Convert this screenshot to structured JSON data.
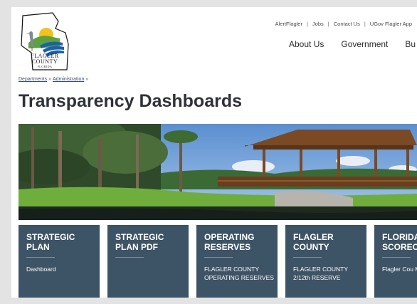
{
  "logo": {
    "line1": "FLAGLER",
    "line2": "COUNTY",
    "line3": "FLORIDA",
    "icon": "heron-landscape-logo"
  },
  "utility_nav": [
    "AlertFlagler",
    "Jobs",
    "Contact Us",
    "UGov Flagler App"
  ],
  "utility_separator": "|",
  "main_nav": [
    "About Us",
    "Government",
    "Bu"
  ],
  "breadcrumb": {
    "items": [
      "Departments",
      "Administration"
    ],
    "separator": "»"
  },
  "page_title": "Transparency Dashboards",
  "hero": {
    "description_icon": "covered-bridge-photo"
  },
  "cards": [
    {
      "title": "STRATEGIC PLAN",
      "desc": "Dashboard"
    },
    {
      "title": "STRATEGIC PLAN PDF",
      "desc": ""
    },
    {
      "title": "OPERATING RESERVES",
      "desc": "FLAGLER COUNTY OPERATING RESERVES"
    },
    {
      "title": "FLAGLER COUNTY",
      "desc": "FLAGLER COUNTY 2/12th RESERVE"
    },
    {
      "title": "FLORIDA SCOREC",
      "desc": "Flagler Cou Metrics"
    }
  ],
  "colors": {
    "card_bg": "#3d5366",
    "title_text": "#2f3238",
    "link": "#3a4d7a"
  }
}
